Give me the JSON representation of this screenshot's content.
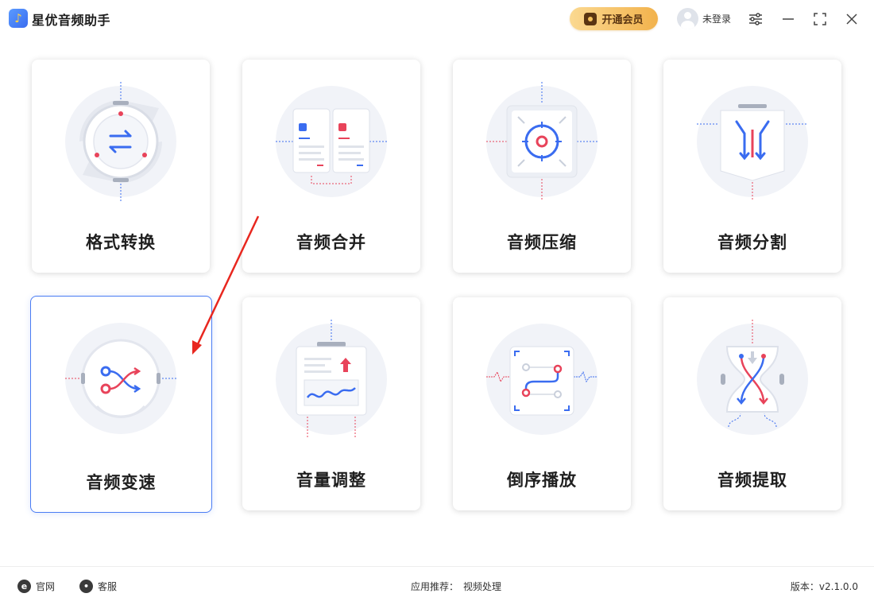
{
  "app": {
    "title": "星优音频助手",
    "logo_glyph": "♪"
  },
  "header": {
    "vip_label": "开通会员",
    "login_label": "未登录"
  },
  "tools": [
    {
      "label": "格式转换"
    },
    {
      "label": "音频合并"
    },
    {
      "label": "音频压缩"
    },
    {
      "label": "音频分割"
    },
    {
      "label": "音频变速"
    },
    {
      "label": "音量调整"
    },
    {
      "label": "倒序播放"
    },
    {
      "label": "音频提取"
    }
  ],
  "footer": {
    "website_label": "官网",
    "service_label": "客服",
    "recommend_label": "应用推荐：",
    "recommend_link": "视频处理",
    "version_label": "版本：",
    "version_value": "v2.1.0.0"
  },
  "colors": {
    "accent_blue": "#3a6cf0",
    "accent_red": "#e8435a",
    "vip_gold": "#f2b24c"
  }
}
